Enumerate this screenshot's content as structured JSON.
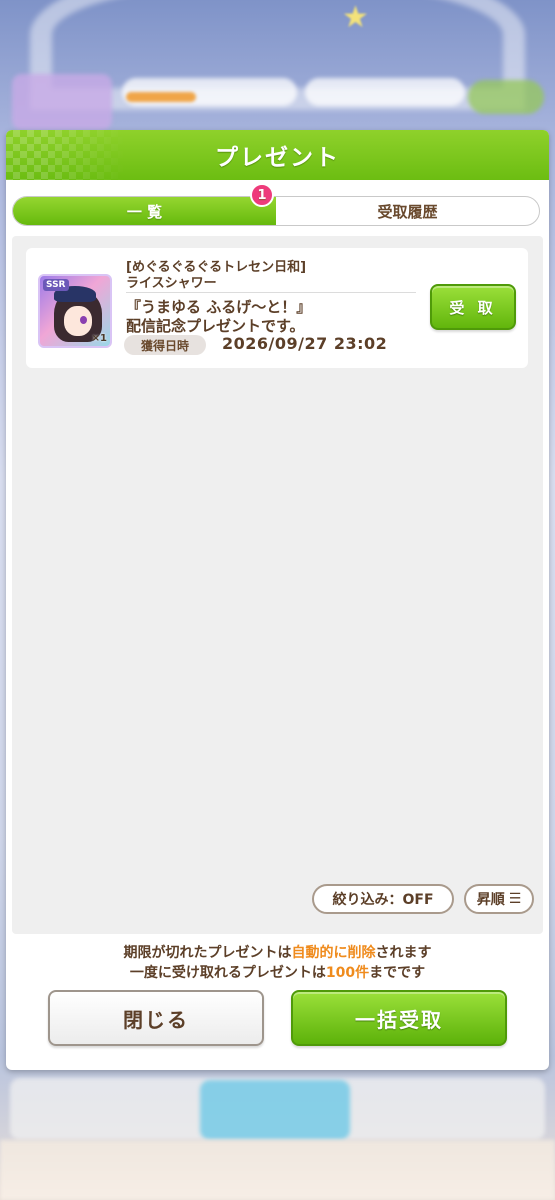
{
  "modal": {
    "title": "プレゼント"
  },
  "tabs": [
    {
      "label": "一 覧",
      "badge": "1",
      "active": true
    },
    {
      "label": "受取履歴",
      "active": false
    }
  ],
  "presents": [
    {
      "rarity": "SSR",
      "quantity": "×1",
      "icon": "support-card-rice-shower",
      "title_line1": "[めぐるぐるぐるトレセン日和]",
      "title_line2": "ライスシャワー",
      "desc_line1": "『うまゆる ふるげ〜と！』",
      "desc_line2": "配信記念プレゼントです。",
      "date_label": "獲得日時",
      "date_value": "2026/09/27 23:02",
      "receive_label": "受 取"
    }
  ],
  "controls": {
    "filter_label": "絞り込み：OFF",
    "sort_label": "昇順",
    "sort_icon": "list-sort-icon"
  },
  "notes": {
    "line1_a": "期限が切れたプレゼントは",
    "line1_highlight": "自動的に削除",
    "line1_b": "されます",
    "line2_a": "一度に受け取れるプレゼントは",
    "line2_highlight": "100件",
    "line2_b": "までです"
  },
  "buttons": {
    "close": "閉じる",
    "receive_all": "一括受取"
  },
  "colors": {
    "accent_green": "#6cbd12",
    "badge_pink": "#ee3b7b",
    "highlight_orange": "#ef8b1d",
    "text_brown": "#5c3f28"
  }
}
